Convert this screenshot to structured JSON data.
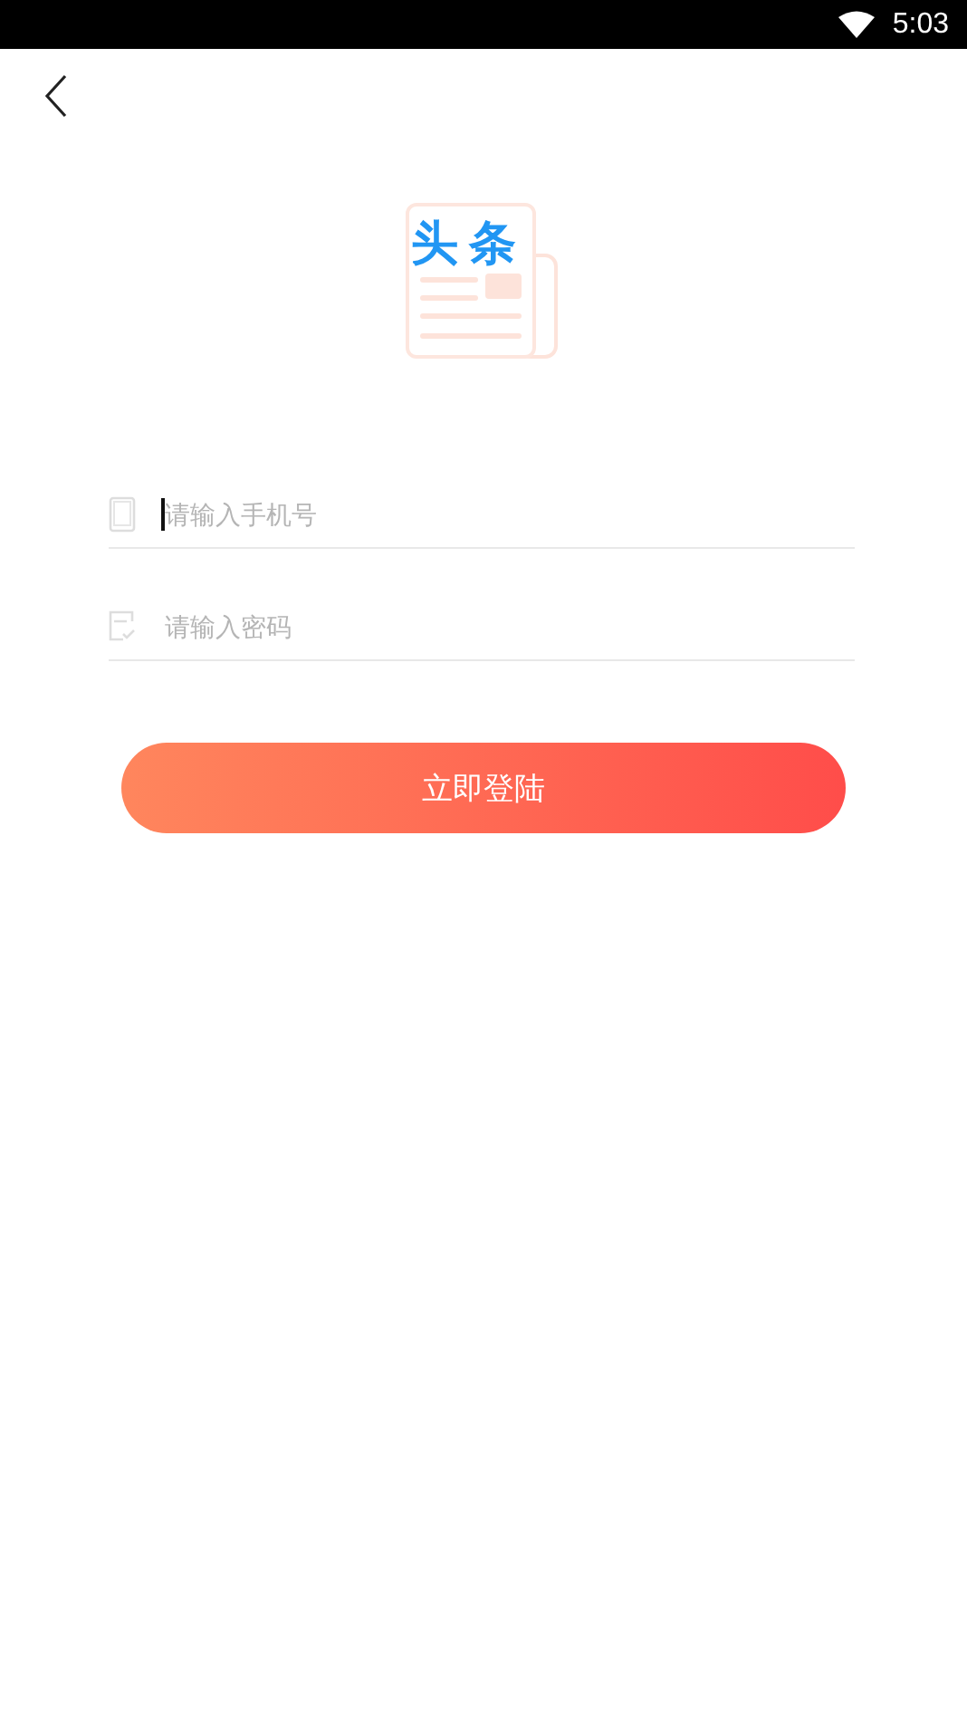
{
  "status_bar": {
    "time": "5:03"
  },
  "logo": {
    "text": "头条"
  },
  "fields": [
    {
      "kind": "phone",
      "placeholder": "请输入手机号",
      "focused": true
    },
    {
      "kind": "password",
      "placeholder": "请输入密码",
      "focused": false
    }
  ],
  "login_button": {
    "label": "立即登陆"
  }
}
